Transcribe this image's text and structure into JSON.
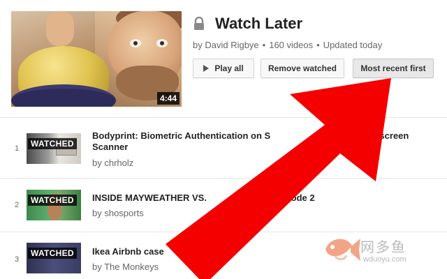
{
  "playlist": {
    "title": "Watch Later",
    "owner": "by David Rigbye",
    "video_count": "160 videos",
    "updated": "Updated today",
    "separator": "•",
    "thumbnail_duration": "4:44"
  },
  "actions": {
    "play_all": "Play all",
    "remove_watched": "Remove watched",
    "sort": "Most recent first"
  },
  "videos": [
    {
      "index": "1",
      "title": "Bodyprint: Biometric Authentication on Smartphones Using the Touchscreen as Scanner",
      "title_visible": "Bodyprint: Biometric Authentication on S",
      "title_visible_end": "ing the Touchscreen",
      "title_line2": "Scanner",
      "owner": "by chrholz",
      "badge": "WATCHED"
    },
    {
      "index": "2",
      "title_visible": "INSIDE MAYWEATHER VS.",
      "title_visible_end": "| Episode 2",
      "owner": "by shosports",
      "badge": "WATCHED"
    },
    {
      "index": "3",
      "title_visible": "Ikea Airbnb case",
      "owner": "by The Monkeys",
      "badge": "WATCHED"
    }
  ],
  "watermark": {
    "text": "网多鱼",
    "domain": "wduoyu.com"
  },
  "colors": {
    "arrow": "#f40000",
    "button_bg": "#f8f8f8",
    "divider": "#e5e5e5"
  }
}
